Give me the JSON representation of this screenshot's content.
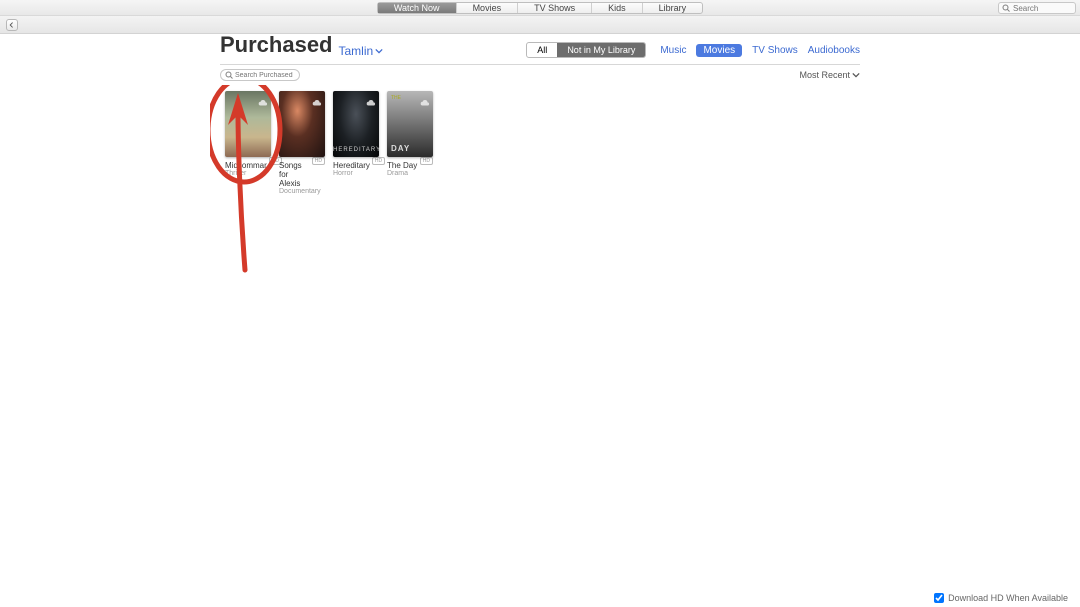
{
  "topnav": {
    "tabs": [
      "Watch Now",
      "Movies",
      "TV Shows",
      "Kids",
      "Library"
    ],
    "active_index": 0,
    "search_placeholder": "Search"
  },
  "page": {
    "title": "Purchased",
    "account_name": "Tamlin"
  },
  "library_filter": {
    "options": [
      "All",
      "Not in My Library"
    ],
    "active_index": 1
  },
  "categories": {
    "items": [
      "Music",
      "Movies",
      "TV Shows",
      "Audiobooks"
    ],
    "active_index": 1
  },
  "local_search_placeholder": "Search Purchased Items",
  "sort": {
    "label": "Most Recent"
  },
  "movies": [
    {
      "title": "Midsommar",
      "genre": "Thriller",
      "thumb_class": "a",
      "overlay_text": ""
    },
    {
      "title": "Songs for Alexis",
      "genre": "Documentary",
      "thumb_class": "b",
      "overlay_text": ""
    },
    {
      "title": "Hereditary",
      "genre": "Horror",
      "thumb_class": "c",
      "overlay_text": "HEREDITARY"
    },
    {
      "title": "The Day",
      "genre": "Drama",
      "thumb_class": "d",
      "overlay_text": ""
    }
  ],
  "footer": {
    "checkbox_label": "Download HD When Available",
    "checked": true
  }
}
